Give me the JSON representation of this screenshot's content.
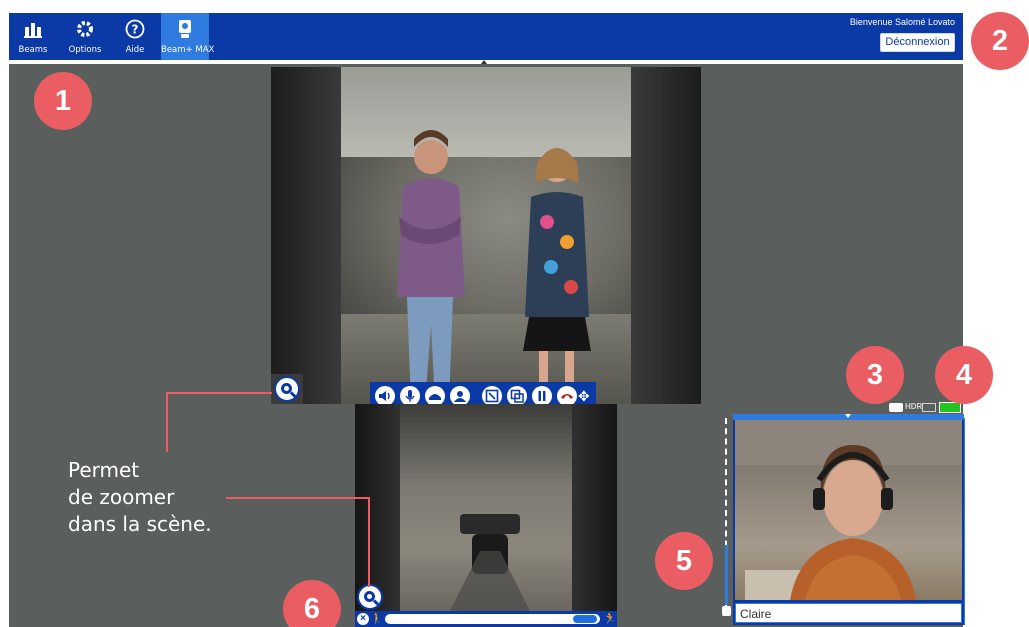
{
  "topbar": {
    "nav": [
      {
        "label": "Beams",
        "icon": "beams-icon"
      },
      {
        "label": "Options",
        "icon": "gear-icon"
      },
      {
        "label": "Aide",
        "icon": "help-icon"
      },
      {
        "label": "Beam+ MAX",
        "icon": "robot-icon",
        "active": true
      }
    ],
    "welcome": "Bienvenue Salomé Lovato",
    "logout_label": "Déconnexion"
  },
  "callouts": {
    "b1": "1",
    "b2": "2",
    "b3": "3",
    "b4": "4",
    "b5": "5",
    "b6": "6",
    "zoom_text": [
      "Permet",
      "de zoomer",
      "dans la scène."
    ]
  },
  "status": {
    "hdr_label": "HDR",
    "battery_level": 1.0
  },
  "self_view": {
    "name_value": "Claire"
  },
  "colors": {
    "topbar": "#0b3aa7",
    "active_nav": "#2f7be0",
    "badge": "#ea5d62",
    "stage": "#5a5f5e",
    "battery": "#22c51e"
  }
}
